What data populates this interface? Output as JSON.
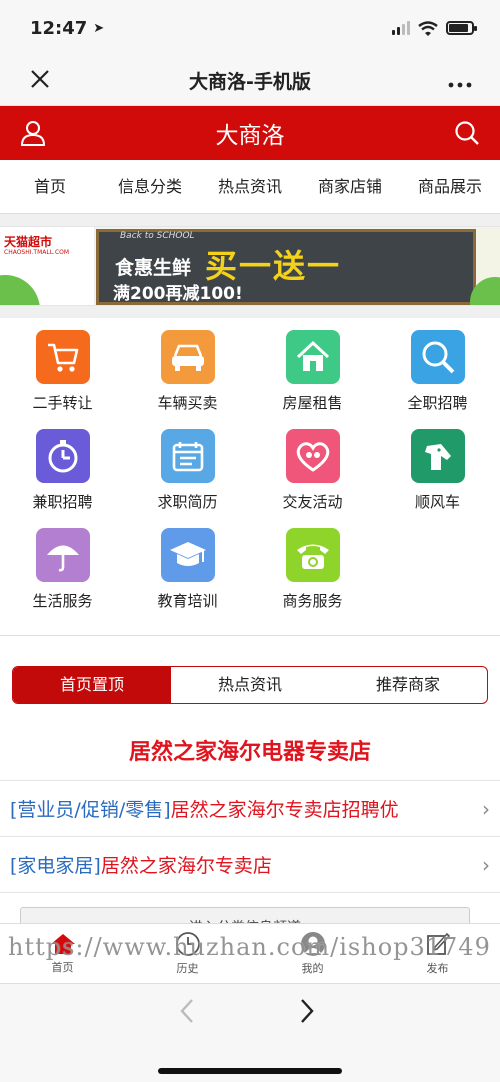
{
  "status": {
    "time": "12:47",
    "battery_level": 0.85
  },
  "browser": {
    "title": "大商洛-手机版",
    "close_icon": "close-icon",
    "more_icon": "more-icon"
  },
  "site": {
    "title": "大商洛",
    "brand_color": "#d10a0a",
    "user_icon": "user-icon",
    "search_icon": "search-icon"
  },
  "tabs": [
    {
      "label": "首页",
      "active": true
    },
    {
      "label": "信息分类",
      "active": false
    },
    {
      "label": "热点资讯",
      "active": false
    },
    {
      "label": "商家店铺",
      "active": false
    },
    {
      "label": "商品展示",
      "active": false
    }
  ],
  "banner": {
    "brand": "天猫超市",
    "brand_sub": "CHAOSHI.TMALL.COM",
    "tag": "Back to SCHOOL",
    "line1": "食惠生鲜",
    "big": "买一送一",
    "line2": "满200再减100!"
  },
  "categories": [
    {
      "label": "二手转让",
      "icon": "cart-icon",
      "color": "#f56a1d"
    },
    {
      "label": "车辆买卖",
      "icon": "car-icon",
      "color": "#f39a3c"
    },
    {
      "label": "房屋租售",
      "icon": "house-icon",
      "color": "#3fc986"
    },
    {
      "label": "全职招聘",
      "icon": "magnifier-icon",
      "color": "#3aa3e3"
    },
    {
      "label": "兼职招聘",
      "icon": "stopwatch-icon",
      "color": "#6a5bd8"
    },
    {
      "label": "求职简历",
      "icon": "calendar-icon",
      "color": "#58a8e6"
    },
    {
      "label": "交友活动",
      "icon": "heart-icon",
      "color": "#f0557a"
    },
    {
      "label": "顺风车",
      "icon": "dog-icon",
      "color": "#219a6a"
    },
    {
      "label": "生活服务",
      "icon": "umbrella-icon",
      "color": "#b37fd0"
    },
    {
      "label": "教育培训",
      "icon": "graduation-cap-icon",
      "color": "#5f9be8"
    },
    {
      "label": "商务服务",
      "icon": "telephone-icon",
      "color": "#8fd42a"
    }
  ],
  "segments": [
    {
      "label": "首页置顶",
      "active": true
    },
    {
      "label": "热点资讯",
      "active": false
    },
    {
      "label": "推荐商家",
      "active": false
    }
  ],
  "store_title": "居然之家海尔电器专卖店",
  "listings": [
    {
      "tag": "[营业员/促销/零售]",
      "text": "居然之家海尔专卖店招聘优"
    },
    {
      "tag": "[家电家居]",
      "text": "居然之家海尔专卖店"
    }
  ],
  "enter_button": "进入分类信息频道",
  "bottom_nav": [
    {
      "label": "首页",
      "icon": "home-icon"
    },
    {
      "label": "历史",
      "icon": "clock-icon"
    },
    {
      "label": "我的",
      "icon": "profile-icon"
    },
    {
      "label": "发布",
      "icon": "edit-icon"
    }
  ],
  "watermark": "https://www.huzhan.com/ishop31749"
}
